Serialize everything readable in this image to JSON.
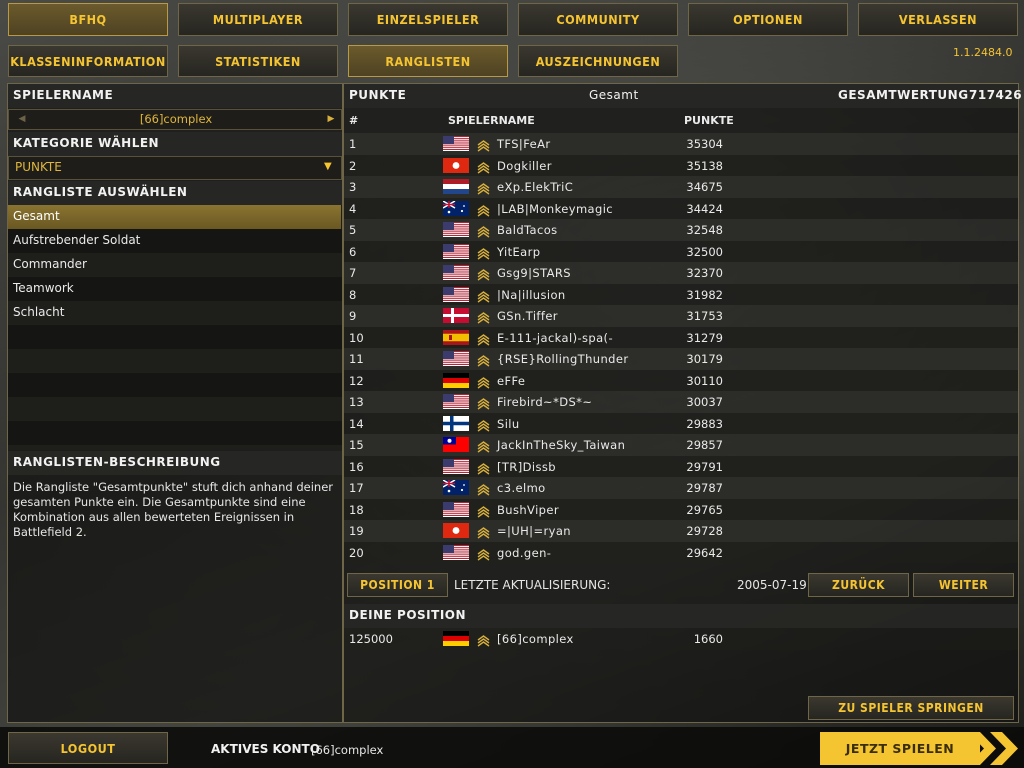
{
  "top_nav": [
    "BFHQ",
    "MULTIPLAYER",
    "EINZELSPIELER",
    "COMMUNITY",
    "OPTIONEN",
    "VERLASSEN"
  ],
  "sub_nav": [
    "KLASSENINFORMATION",
    "STATISTIKEN",
    "RANGLISTEN",
    "AUSZEICHNUNGEN"
  ],
  "version": "1.1.2484.0",
  "left": {
    "player_name_label": "SPIELERNAME",
    "player_name_value": "[66]complex",
    "category_label": "KATEGORIE WÄHLEN",
    "category_value": "PUNKTE",
    "ranking_label": "RANGLISTE AUSWÄHLEN",
    "rankings": [
      "Gesamt",
      "Aufstrebender Soldat",
      "Commander",
      "Teamwork",
      "Schlacht"
    ],
    "desc_label": "RANGLISTEN-BESCHREIBUNG",
    "desc_lines": [
      "Die Rangliste \"Gesamtpunkte\" stuft dich anhand deiner",
      "gesamten Punkte ein. Die Gesamtpunkte sind eine",
      "Kombination aus allen bewerteten Ereignissen in",
      "Battlefield 2."
    ]
  },
  "right": {
    "title": "PUNKTE",
    "subtitle": "Gesamt",
    "total_label": "GESAMTWERTUNG",
    "total_value": "717426",
    "col_rank": "#",
    "col_name": "SPIELERNAME",
    "col_points": "PUNKTE",
    "rows": [
      {
        "rank": "1",
        "flag": "us",
        "name": "TFS|FeAr",
        "points": "35304"
      },
      {
        "rank": "2",
        "flag": "hk",
        "name": "Dogkiller",
        "points": "35138"
      },
      {
        "rank": "3",
        "flag": "nl",
        "name": "eXp.ElekTriC",
        "points": "34675"
      },
      {
        "rank": "4",
        "flag": "au",
        "name": "|LAB|Monkeymagic",
        "points": "34424"
      },
      {
        "rank": "5",
        "flag": "us",
        "name": "BaldTacos",
        "points": "32548"
      },
      {
        "rank": "6",
        "flag": "us",
        "name": "YitEarp",
        "points": "32500"
      },
      {
        "rank": "7",
        "flag": "us",
        "name": "Gsg9|STARS",
        "points": "32370"
      },
      {
        "rank": "8",
        "flag": "us",
        "name": "|Na|illusion",
        "points": "31982"
      },
      {
        "rank": "9",
        "flag": "dk",
        "name": "GSn.Tiffer",
        "points": "31753"
      },
      {
        "rank": "10",
        "flag": "es",
        "name": "E-111-jackal)-spa(-",
        "points": "31279"
      },
      {
        "rank": "11",
        "flag": "us",
        "name": "{RSE}RollingThunder",
        "points": "30179"
      },
      {
        "rank": "12",
        "flag": "de",
        "name": "eFFe",
        "points": "30110"
      },
      {
        "rank": "13",
        "flag": "us",
        "name": "Firebird~*DS*~",
        "points": "30037"
      },
      {
        "rank": "14",
        "flag": "fi",
        "name": "Silu",
        "points": "29883"
      },
      {
        "rank": "15",
        "flag": "tw",
        "name": "JackInTheSky_Taiwan",
        "points": "29857"
      },
      {
        "rank": "16",
        "flag": "us",
        "name": "[TR]Dissb",
        "points": "29791"
      },
      {
        "rank": "17",
        "flag": "au",
        "name": "c3.elmo",
        "points": "29787"
      },
      {
        "rank": "18",
        "flag": "us",
        "name": "BushViper",
        "points": "29765"
      },
      {
        "rank": "19",
        "flag": "hk",
        "name": "=|UH|=ryan",
        "points": "29728"
      },
      {
        "rank": "20",
        "flag": "us",
        "name": "god.gen-",
        "points": "29642"
      }
    ],
    "position_button": "POSITION 1",
    "last_update_label": "LETZTE AKTUALISIERUNG:",
    "last_update_value": "2005-07-19",
    "back_button": "ZURÜCK",
    "next_button": "WEITER",
    "your_position_label": "DEINE POSITION",
    "your_position": {
      "rank": "125000",
      "flag": "de",
      "name": "[66]complex",
      "points": "1660"
    },
    "jump_button": "ZU SPIELER SPRINGEN"
  },
  "footer": {
    "logout": "LOGOUT",
    "account_label": "AKTIVES KONTO",
    "account_value": "[66]complex",
    "play_button": "JETZT SPIELEN"
  },
  "colors": {
    "accent": "#f5c431",
    "selected": "#8a7430",
    "border": "#6f6648"
  }
}
